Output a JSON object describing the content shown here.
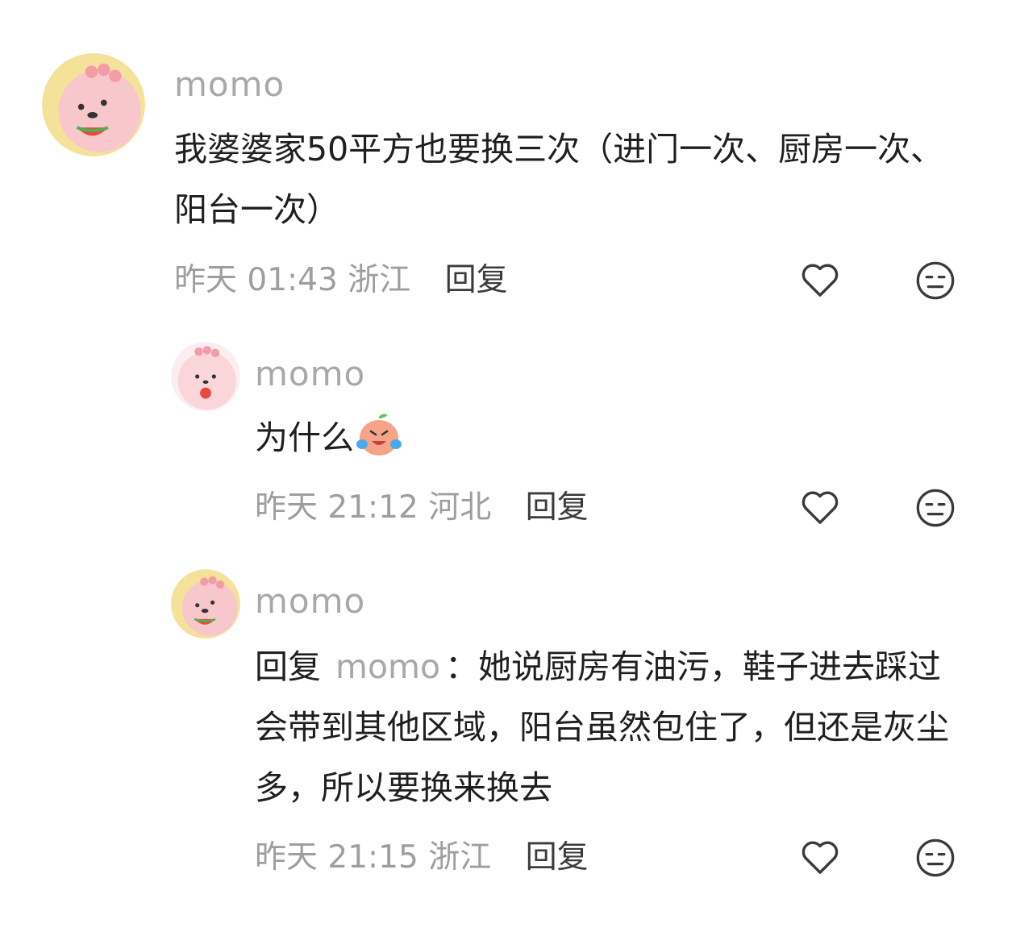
{
  "comments": [
    {
      "username": "momo",
      "text": "我婆婆家50平方也要换三次（进门一次、厨房一次、阳台一次）",
      "time": "昨天 01:43",
      "location": "浙江",
      "reply_label": "回复"
    },
    {
      "username": "momo",
      "text": "为什么",
      "emoji": "crying-laughing-peach-emoji",
      "time": "昨天 21:12",
      "location": "河北",
      "reply_label": "回复"
    },
    {
      "username": "momo",
      "reply_prefix": "回复",
      "reply_target": "momo",
      "reply_colon": "：",
      "text": "她说厨房有油污，鞋子进去踩过会带到其他区域，阳台虽然包住了，但还是灰尘多，所以要换来换去",
      "time": "昨天 21:15",
      "location": "浙江",
      "reply_label": "回复"
    }
  ],
  "icons": {
    "like": "heart-outline-icon",
    "dislike": "unamused-face-icon"
  },
  "colors": {
    "username": "#a8a8a8",
    "text": "#1f1f1f",
    "meta": "#9e9e9e",
    "reply": "#3b3b3b",
    "avatar_pink": "#f6c6c9",
    "avatar_yellow": "#f4e29a"
  }
}
